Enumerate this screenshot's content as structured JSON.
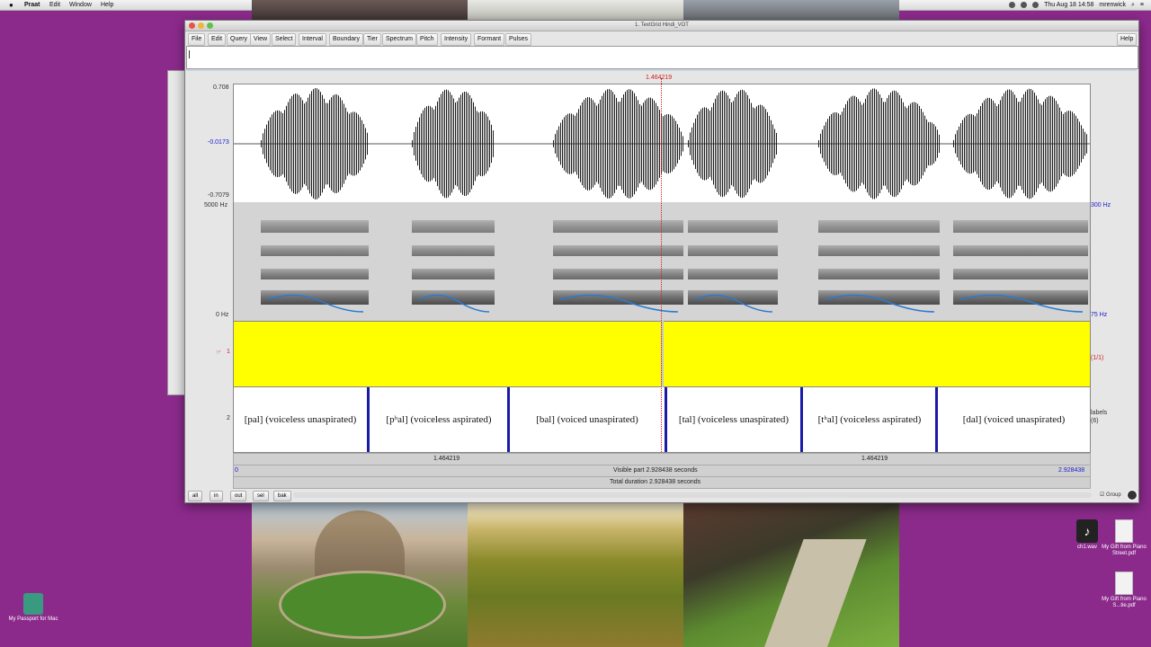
{
  "menubar": {
    "app": "Praat",
    "items": [
      "Edit",
      "Window",
      "Help"
    ],
    "clock": "Thu Aug 18  14:58",
    "user": "mrenwick"
  },
  "window": {
    "title": "1. TextGrid Hindi_VOT",
    "menus": [
      "File",
      "Edit",
      "Query",
      "View",
      "Select",
      "Interval",
      "Boundary",
      "Tier",
      "Spectrum",
      "Pitch",
      "Intensity",
      "Formant",
      "Pulses"
    ],
    "help": "Help"
  },
  "cursor_time": "1.464219",
  "waveform": {
    "top": "0.708",
    "mid": "-0.0173",
    "bottom": "-0.7079"
  },
  "spectrogram": {
    "top_freq": "5000 Hz",
    "bottom_freq": "0 Hz",
    "pitch_top": "300 Hz",
    "pitch_bottom": "75 Hz"
  },
  "tiers": {
    "tier1": {
      "number": "1",
      "counter": "(1/1)"
    },
    "tier2": {
      "number": "2",
      "side_label": "labels",
      "side_count": "(6)",
      "intervals": [
        "[pal] (voiceless unaspirated)",
        "[pʰal] (voiceless aspirated)",
        "[bal] (voiced unaspirated)",
        "[tal] (voiceless unaspirated)",
        "[tʰal] (voiceless aspirated)",
        "[dal] (voiced unaspirated)"
      ]
    }
  },
  "info": {
    "left_seg": "1.464219",
    "right_seg": "1.464219",
    "start": "0",
    "visible": "Visible part 2.928438 seconds",
    "end": "2.928438",
    "total": "Total duration 2.928438 seconds"
  },
  "buttons": {
    "all": "all",
    "in": "in",
    "out": "out",
    "sel": "sel",
    "bak": "bak",
    "group": "Group"
  },
  "desktop": {
    "icon_passport": "My Passport for Mac",
    "icon_wav": "ch1.wav",
    "icon_pdf1": "My Gift from Piano Street.pdf",
    "icon_pdf2": "My Gift from Piano S...tie.pdf"
  },
  "colors": {
    "tier_yellow": "#ffff00",
    "boundary_blue": "#1a1aa8",
    "pitch_blue": "#2a7ad0",
    "cursor_red": "#d02020",
    "desktop_purple": "#8c2a8c"
  }
}
